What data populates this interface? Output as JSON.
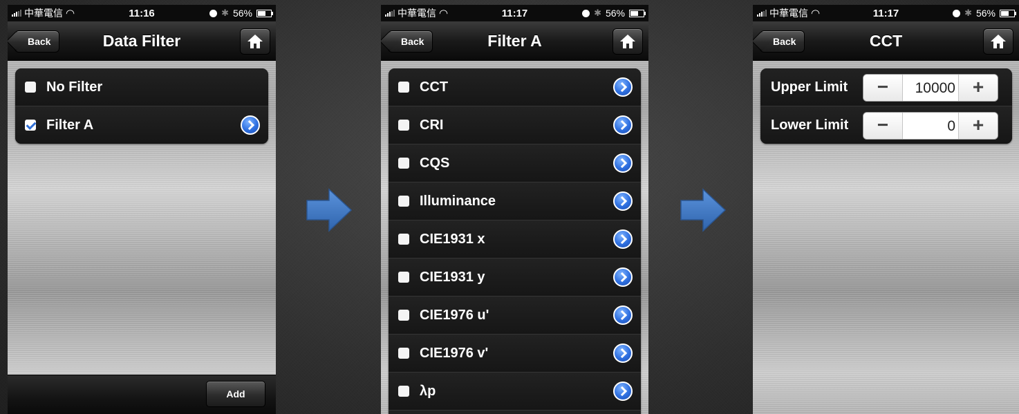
{
  "screens": [
    {
      "status": {
        "carrier": "中華電信",
        "time": "11:16",
        "battery": "56%"
      },
      "nav": {
        "back_label": "Back",
        "title": "Data Filter"
      },
      "rows": [
        {
          "label": "No Filter",
          "checked": false,
          "disclosure": false
        },
        {
          "label": "Filter A",
          "checked": true,
          "disclosure": true
        }
      ],
      "toolbar": {
        "add_label": "Add"
      }
    },
    {
      "status": {
        "carrier": "中華電信",
        "time": "11:17",
        "battery": "56%"
      },
      "nav": {
        "back_label": "Back",
        "title": "Filter A"
      },
      "rows": [
        {
          "label": "CCT",
          "checked": false,
          "disclosure": true
        },
        {
          "label": "CRI",
          "checked": false,
          "disclosure": true
        },
        {
          "label": "CQS",
          "checked": false,
          "disclosure": true
        },
        {
          "label": "Illuminance",
          "checked": false,
          "disclosure": true
        },
        {
          "label": "CIE1931 x",
          "checked": false,
          "disclosure": true
        },
        {
          "label": "CIE1931 y",
          "checked": false,
          "disclosure": true
        },
        {
          "label": "CIE1976 u'",
          "checked": false,
          "disclosure": true
        },
        {
          "label": "CIE1976 v'",
          "checked": false,
          "disclosure": true
        },
        {
          "label": "λp",
          "checked": false,
          "disclosure": true
        }
      ]
    },
    {
      "status": {
        "carrier": "中華電信",
        "time": "11:17",
        "battery": "56%"
      },
      "nav": {
        "back_label": "Back",
        "title": "CCT"
      },
      "limits": [
        {
          "label": "Upper Limit",
          "value": "10000",
          "minus": "−",
          "plus": "+"
        },
        {
          "label": "Lower Limit",
          "value": "0",
          "minus": "−",
          "plus": "+"
        }
      ]
    }
  ],
  "icons": {
    "navigation_arrows": "right-arrow-icon",
    "home": "home-icon",
    "disclosure": "chevron-right-circle-icon"
  },
  "colors": {
    "accent": "#2e6fe0",
    "arrow": "#3a78c9"
  }
}
